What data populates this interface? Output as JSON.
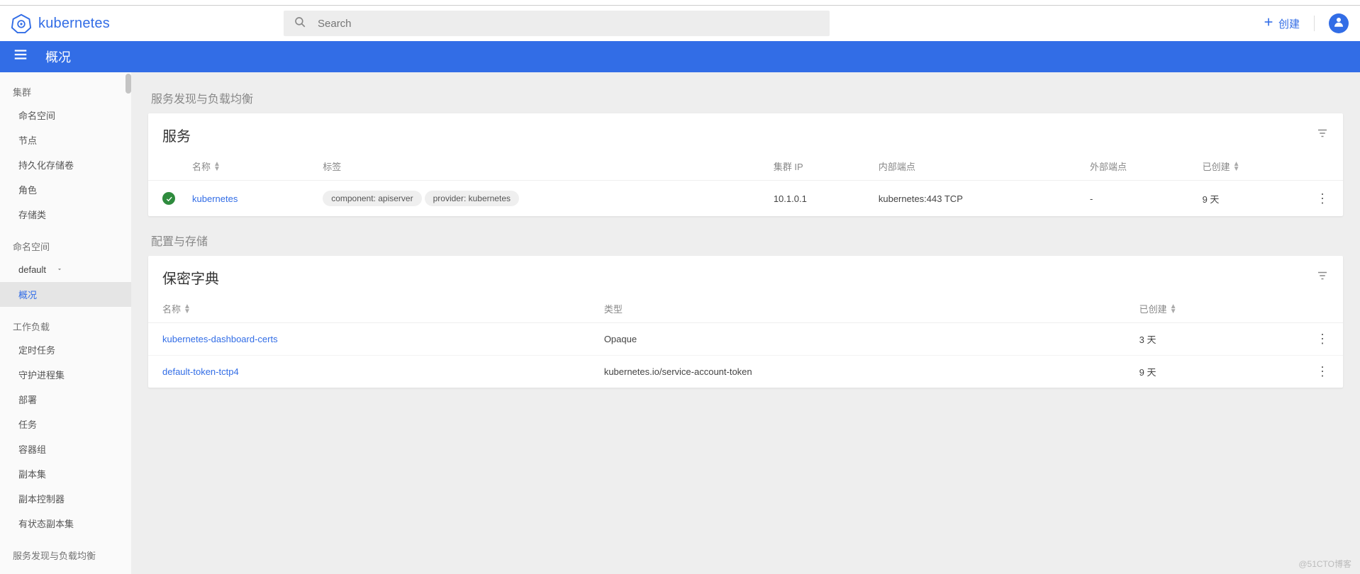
{
  "top": {
    "logo_text": "kubernetes",
    "search_placeholder": "Search",
    "create_label": "创建"
  },
  "header": {
    "title": "概况"
  },
  "sidebar": {
    "cluster_header": "集群",
    "cluster_items": [
      "命名空间",
      "节点",
      "持久化存储卷",
      "角色",
      "存储类"
    ],
    "ns_header": "命名空间",
    "ns_selected": "default",
    "overview": "概况",
    "workloads_header": "工作负载",
    "workloads_items": [
      "定时任务",
      "守护进程集",
      "部署",
      "任务",
      "容器组",
      "副本集",
      "副本控制器",
      "有状态副本集"
    ],
    "svc_header": "服务发现与负载均衡"
  },
  "sections": {
    "svc_lb": "服务发现与负载均衡",
    "config_storage": "配置与存储"
  },
  "services_card": {
    "title": "服务",
    "columns": {
      "name": "名称",
      "labels": "标签",
      "cluster_ip": "集群 IP",
      "internal_ep": "内部端点",
      "external_ep": "外部端点",
      "created": "已创建"
    },
    "rows": [
      {
        "name": "kubernetes",
        "labels": [
          "component: apiserver",
          "provider: kubernetes"
        ],
        "cluster_ip": "10.1.0.1",
        "internal_ep": "kubernetes:443 TCP",
        "external_ep": "-",
        "created": "9 天"
      }
    ]
  },
  "secrets_card": {
    "title": "保密字典",
    "columns": {
      "name": "名称",
      "type": "类型",
      "created": "已创建"
    },
    "rows": [
      {
        "name": "kubernetes-dashboard-certs",
        "type": "Opaque",
        "created": "3 天"
      },
      {
        "name": "default-token-tctp4",
        "type": "kubernetes.io/service-account-token",
        "created": "9 天"
      }
    ]
  },
  "watermark": "@51CTO博客"
}
